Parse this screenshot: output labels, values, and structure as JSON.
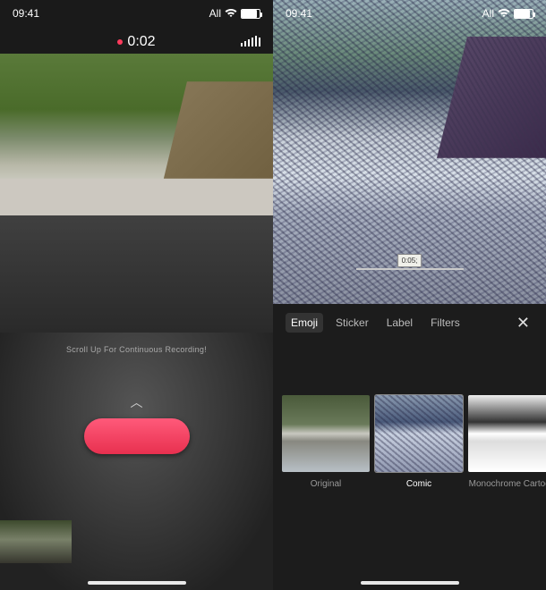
{
  "status": {
    "time": "09:41",
    "network_label": "All"
  },
  "left": {
    "recording_timer": "0:02",
    "scroll_hint": "Scroll Up For Continuous Recording!",
    "chevron_glyph": "︿"
  },
  "right": {
    "timestamp_chip": "0:05;",
    "tabs": {
      "emoji": "Emoji",
      "sticker": "Sticker",
      "label": "Label",
      "filters": "Filters"
    },
    "close_glyph": "✕",
    "filters": [
      {
        "name": "Original"
      },
      {
        "name": "Comic"
      },
      {
        "name": "Monochrome Cartoon"
      }
    ]
  }
}
